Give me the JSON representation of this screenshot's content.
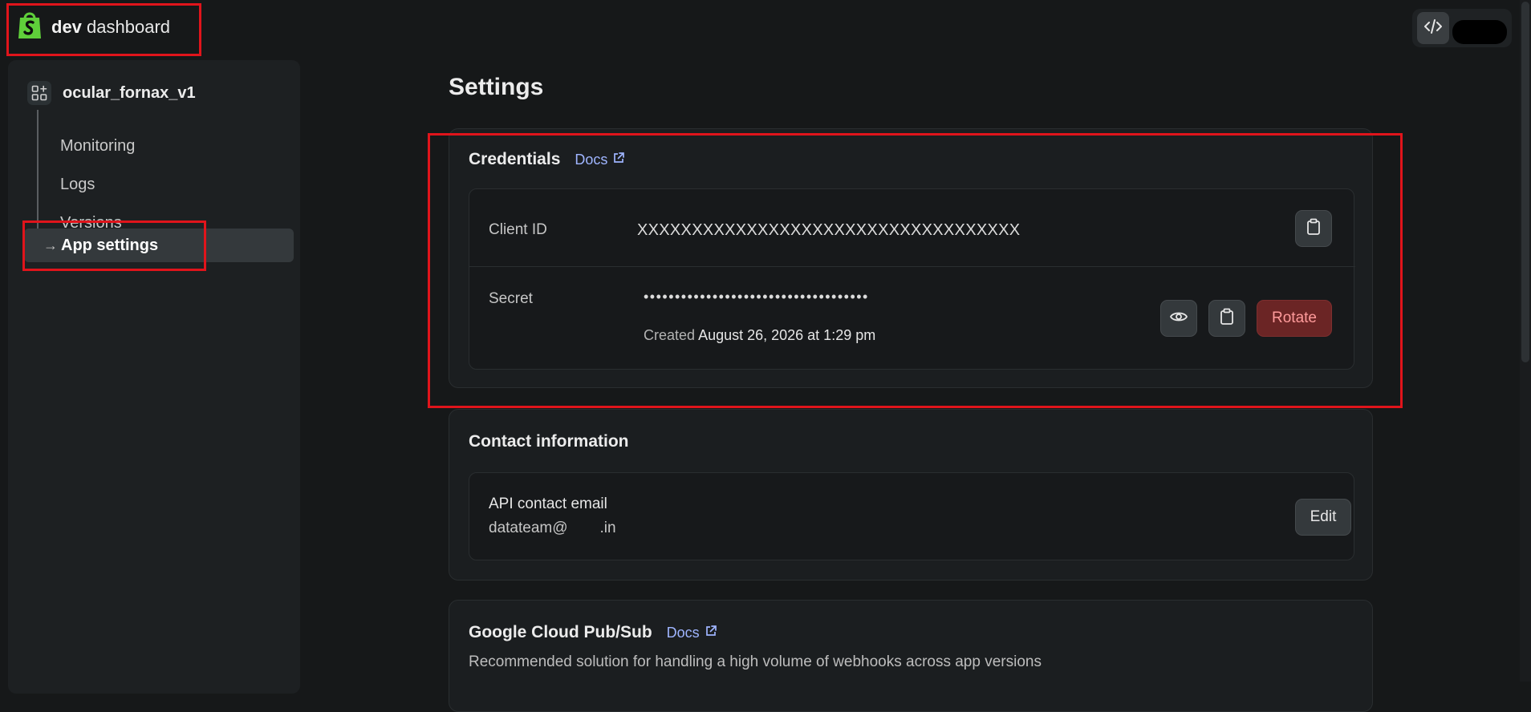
{
  "brand": {
    "bold": "dev",
    "rest": "dashboard",
    "accent": "#5fcf3a"
  },
  "sidebar": {
    "app_name": "ocular_fornax_v1",
    "items": [
      {
        "label": "Monitoring"
      },
      {
        "label": "Logs"
      },
      {
        "label": "Versions"
      },
      {
        "label": "App settings",
        "active": true
      }
    ]
  },
  "main": {
    "title": "Settings",
    "credentials": {
      "title": "Credentials",
      "docs_label": "Docs",
      "client_id_label": "Client ID",
      "client_id_value": "XXXXXXXXXXXXXXXXXXXXXXXXXXXXXXXXXXX",
      "secret_label": "Secret",
      "secret_value": "••••••••••••••••••••••••••••••••••••",
      "created_prefix": "Created",
      "created_value": "August 26, 2026 at 1:29 pm",
      "rotate_label": "Rotate"
    },
    "contact": {
      "title": "Contact information",
      "email_label": "API contact email",
      "email_prefix": "datateam@",
      "email_suffix": ".in",
      "edit_label": "Edit"
    },
    "pubsub": {
      "title": "Google Cloud Pub/Sub",
      "docs_label": "Docs",
      "description": "Recommended solution for handling a high volume of webhooks across app versions"
    }
  },
  "colors": {
    "highlight": "#e0141b",
    "rotate_bg": "#6b2525",
    "link": "#9fb5ff"
  }
}
